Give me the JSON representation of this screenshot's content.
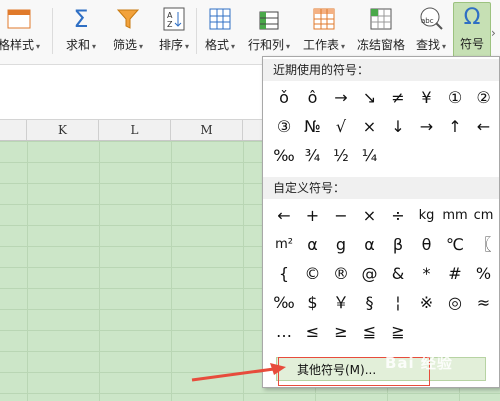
{
  "toolbar": {
    "style_label": "格样式",
    "sum_label": "求和",
    "filter_label": "筛选",
    "sort_label": "排序",
    "format_label": "格式",
    "rowcol_label": "行和列",
    "worksheet_label": "工作表",
    "freeze_label": "冻结窗格",
    "find_label": "查找",
    "symbol_label": "符号",
    "caret": "▾",
    "more": "›",
    "sum_glyph": "Σ",
    "find_glyph": "abc"
  },
  "columns": [
    "K",
    "L",
    "M"
  ],
  "symbol_panel": {
    "recent_title": "近期使用的符号：",
    "recent_rows": [
      [
        "ǒ",
        "ô",
        "→",
        "↘",
        "≠",
        "¥",
        "①",
        "②"
      ],
      [
        "③",
        "№",
        "√",
        "×",
        "↓",
        "→",
        "↑",
        "←"
      ],
      [
        "‰",
        "¾",
        "½",
        "¼"
      ]
    ],
    "custom_title": "自定义符号：",
    "custom_rows": [
      [
        "←",
        "+",
        "−",
        "×",
        "÷",
        "kg",
        "mm",
        "cm"
      ],
      [
        "m²",
        "α",
        "g",
        "α",
        "β",
        "θ",
        "℃",
        "〖"
      ],
      [
        "{",
        "©",
        "®",
        "@",
        "&",
        "*",
        "#",
        "%"
      ],
      [
        "‰",
        "$",
        "￥",
        "§",
        "¦",
        "※",
        "◎",
        "≈"
      ],
      [
        "…",
        "≤",
        "≥",
        "≦",
        "≧"
      ]
    ],
    "more_button": "其他符号(M)..."
  },
  "watermark": "Bai 经验",
  "colors": {
    "accent_green": "#c6e0b4",
    "grid_green": "#cce6c8",
    "annotation_red": "#e74c3c"
  }
}
